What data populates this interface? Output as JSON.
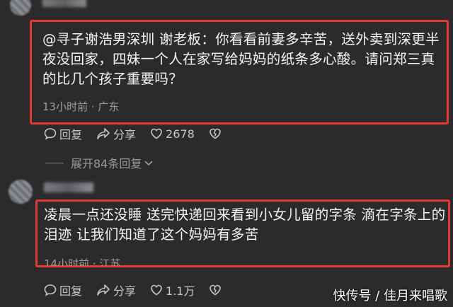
{
  "comments": [
    {
      "text": "@寻子谢浩男深圳 谢老板：你看看前妻多辛苦，送外卖到深更半夜没回家，四妹一个人在家写给妈妈的纸条多心酸。请问郑三真的比几个孩子重要吗？",
      "meta": "13小时前 · 广东",
      "reply_label": "回复",
      "share_label": "分享",
      "like_count": "2678"
    },
    {
      "text": "凌晨一点还没睡 送完快递回来看到小女儿留的字条 滴在字条上的泪迹 让我们知道了这个妈妈有多苦",
      "meta": "14小时前 · 江苏",
      "reply_label": "回复",
      "share_label": "分享",
      "like_count": "1.1万"
    }
  ],
  "expand_replies": "展开84条回复",
  "watermark": "快传号 / 佳月来唱歌",
  "colors": {
    "highlight_box": "#e43a34",
    "background": "#2c2a2a"
  }
}
